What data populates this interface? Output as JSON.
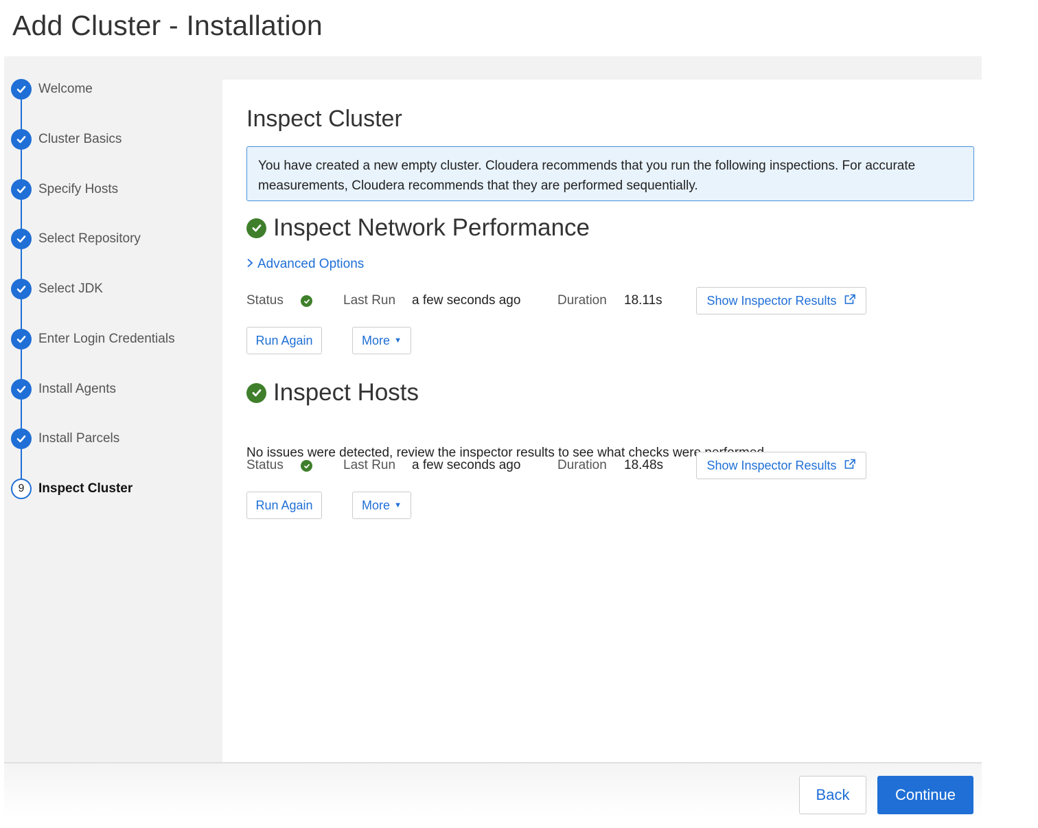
{
  "page_title": "Add Cluster - Installation",
  "steps": [
    {
      "label": "Welcome",
      "state": "done"
    },
    {
      "label": "Cluster Basics",
      "state": "done"
    },
    {
      "label": "Specify Hosts",
      "state": "done"
    },
    {
      "label": "Select Repository",
      "state": "done"
    },
    {
      "label": "Select JDK",
      "state": "done"
    },
    {
      "label": "Enter Login Credentials",
      "state": "done"
    },
    {
      "label": "Install Agents",
      "state": "done"
    },
    {
      "label": "Install Parcels",
      "state": "done"
    },
    {
      "label": "Inspect Cluster",
      "state": "current",
      "number": "9"
    }
  ],
  "main": {
    "title": "Inspect Cluster",
    "info": "You have created a new empty cluster. Cloudera recommends that you run the following inspections. For accurate measurements, Cloudera recommends that they are performed sequentially.",
    "network": {
      "title": "Inspect Network Performance",
      "advanced_link": "Advanced Options",
      "status_label": "Status",
      "last_run_label": "Last Run",
      "last_run_value": "a few seconds ago",
      "duration_label": "Duration",
      "duration_value": "18.11s",
      "show_results": "Show Inspector Results",
      "run_again": "Run Again",
      "more": "More"
    },
    "hosts": {
      "title": "Inspect Hosts",
      "description": "No issues were detected, review the inspector results to see what checks were performed.",
      "status_label": "Status",
      "last_run_label": "Last Run",
      "last_run_value": "a few seconds ago",
      "duration_label": "Duration",
      "duration_value": "18.48s",
      "show_results": "Show Inspector Results",
      "run_again": "Run Again",
      "more": "More"
    }
  },
  "footer": {
    "back": "Back",
    "continue": "Continue"
  },
  "colors": {
    "accent": "#1f6fd6",
    "success": "#3f7f2b",
    "info_bg": "#e8f3fc"
  }
}
